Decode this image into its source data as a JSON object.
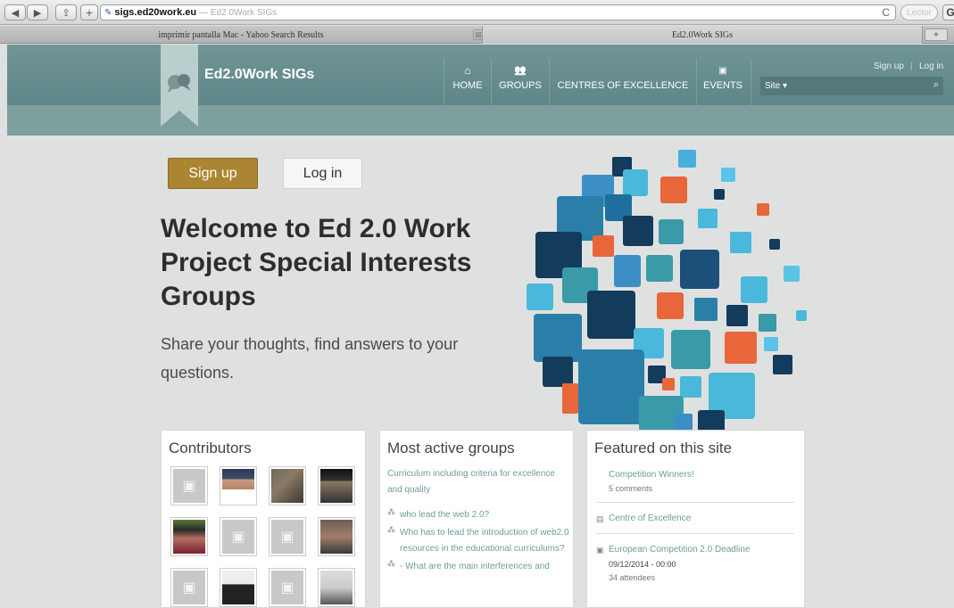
{
  "browser": {
    "back": "◀",
    "forward": "▶",
    "share": "⇪",
    "add": "+",
    "url_domain": "sigs.ed20work.eu",
    "url_title": "— Ed2.0Work SIGs",
    "reload": "C",
    "reader": "Lector",
    "g_button": "G",
    "tabs": [
      {
        "label": "imprimir pantalla Mac - Yahoo Search Results"
      },
      {
        "label": "Ed2.0Work SIGs"
      }
    ],
    "tab_close": "⊠",
    "tab_add": "+"
  },
  "site": {
    "brand": "Ed2.0Work SIGs",
    "nav": [
      {
        "label": "HOME",
        "icon": "home-icon",
        "glyph": "⌂"
      },
      {
        "label": "GROUPS",
        "icon": "groups-icon",
        "glyph": "👥"
      },
      {
        "label": "CENTRES OF EXCELLENCE",
        "icon": "",
        "glyph": ""
      },
      {
        "label": "EVENTS",
        "icon": "calendar-icon",
        "glyph": "▣"
      }
    ],
    "signup_link": "Sign up",
    "login_link": "Log in",
    "search_placeholder": "Site ▾",
    "search_icon": "⌕"
  },
  "hero": {
    "signup_button": "Sign up",
    "login_button": "Log in",
    "title": "Welcome to Ed 2.0 Work Project Special Interests Groups",
    "subtitle": "Share your thoughts, find answers to your questions."
  },
  "contributors": {
    "heading": "Contributors"
  },
  "groups": {
    "heading": "Most active groups",
    "group_name": "Curriculum including criteria for excellence and quality",
    "discussions": [
      {
        "text": "who lead the web 2.0?"
      },
      {
        "text": "Who has to lead the introduction of web2.0 resources in the educational curriculums?"
      },
      {
        "text": "- What are the main interferences and"
      }
    ]
  },
  "featured": {
    "heading": "Featured on this site",
    "items": [
      {
        "title": "Competition Winners!",
        "meta": "5 comments"
      },
      {
        "title": "Centre of Excellence",
        "meta": ""
      },
      {
        "title": "European Competition 2.0 Deadline",
        "date": "09/12/2014 - 00:00",
        "meta": "34 attendees"
      }
    ]
  },
  "colors": {
    "header": "#6f9596",
    "signup_accent": "#ac8532",
    "link": "#6c9e9c"
  }
}
